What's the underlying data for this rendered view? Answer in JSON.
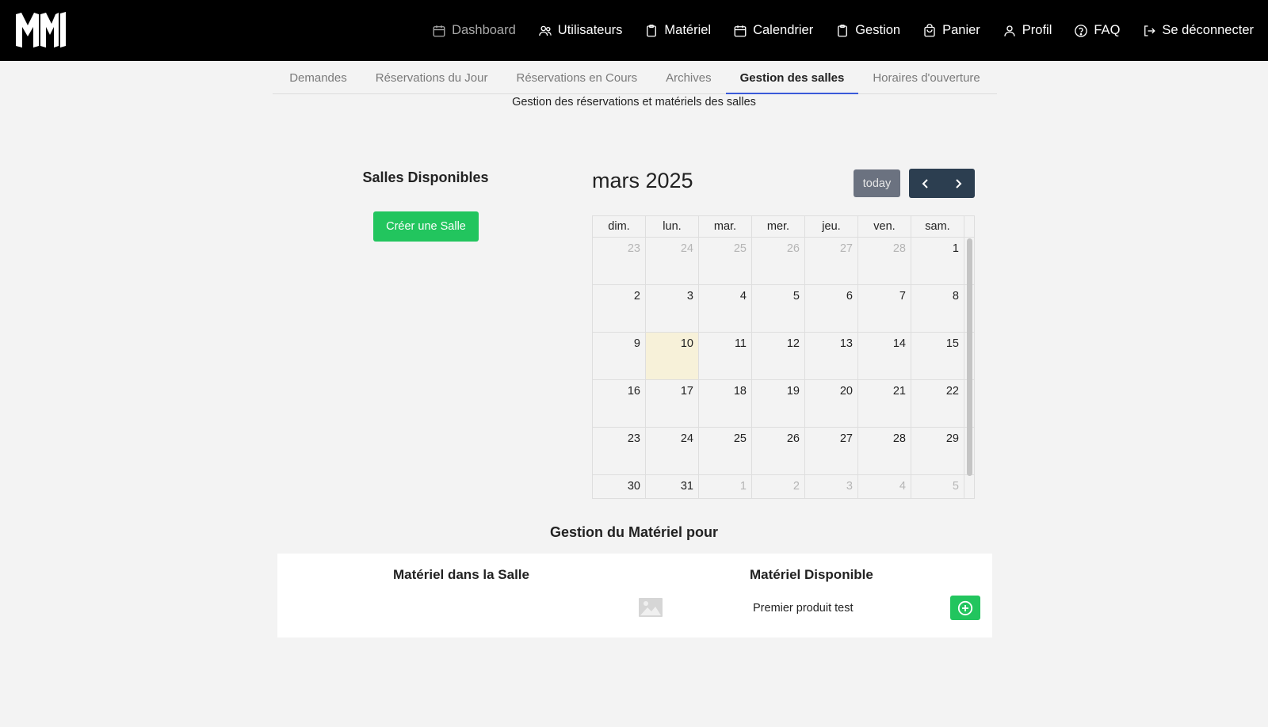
{
  "nav": {
    "items": [
      {
        "label": "Dashboard",
        "icon": "calendar-icon",
        "muted": true
      },
      {
        "label": "Utilisateurs",
        "icon": "users-icon"
      },
      {
        "label": "Matériel",
        "icon": "clipboard-icon"
      },
      {
        "label": "Calendrier",
        "icon": "calendar-icon"
      },
      {
        "label": "Gestion",
        "icon": "clipboard-icon"
      },
      {
        "label": "Panier",
        "icon": "basket-icon"
      },
      {
        "label": "Profil",
        "icon": "user-icon"
      },
      {
        "label": "FAQ",
        "icon": "help-circle-icon"
      },
      {
        "label": "Se déconnecter",
        "icon": "logout-icon"
      }
    ]
  },
  "tabs": [
    {
      "label": "Demandes"
    },
    {
      "label": "Réservations du Jour"
    },
    {
      "label": "Réservations en Cours"
    },
    {
      "label": "Archives"
    },
    {
      "label": "Gestion des salles",
      "active": true
    },
    {
      "label": "Horaires d'ouverture"
    }
  ],
  "subtitle": "Gestion des réservations et matériels des salles",
  "salles": {
    "title": "Salles Disponibles",
    "create_label": "Créer une Salle"
  },
  "calendar": {
    "title": "mars 2025",
    "today_label": "today",
    "day_headers": [
      "dim.",
      "lun.",
      "mar.",
      "mer.",
      "jeu.",
      "ven.",
      "sam."
    ],
    "weeks": [
      [
        "23",
        "24",
        "25",
        "26",
        "27",
        "28",
        "1"
      ],
      [
        "2",
        "3",
        "4",
        "5",
        "6",
        "7",
        "8"
      ],
      [
        "9",
        "10",
        "11",
        "12",
        "13",
        "14",
        "15"
      ],
      [
        "16",
        "17",
        "18",
        "19",
        "20",
        "21",
        "22"
      ],
      [
        "23",
        "24",
        "25",
        "26",
        "27",
        "28",
        "29"
      ],
      [
        "30",
        "31",
        "1",
        "2",
        "3",
        "4",
        "5"
      ]
    ],
    "today_date": "10"
  },
  "materiel": {
    "title": "Gestion du Matériel pour",
    "in_room_title": "Matériel dans la Salle",
    "available_title": "Matériel Disponible",
    "available_items": [
      {
        "name": "Premier produit test"
      }
    ]
  },
  "colors": {
    "accent_green": "#22c55e",
    "nav_bg": "#000000",
    "tab_active_underline": "#3a5ad9",
    "today_bg": "#f7f1d9"
  }
}
